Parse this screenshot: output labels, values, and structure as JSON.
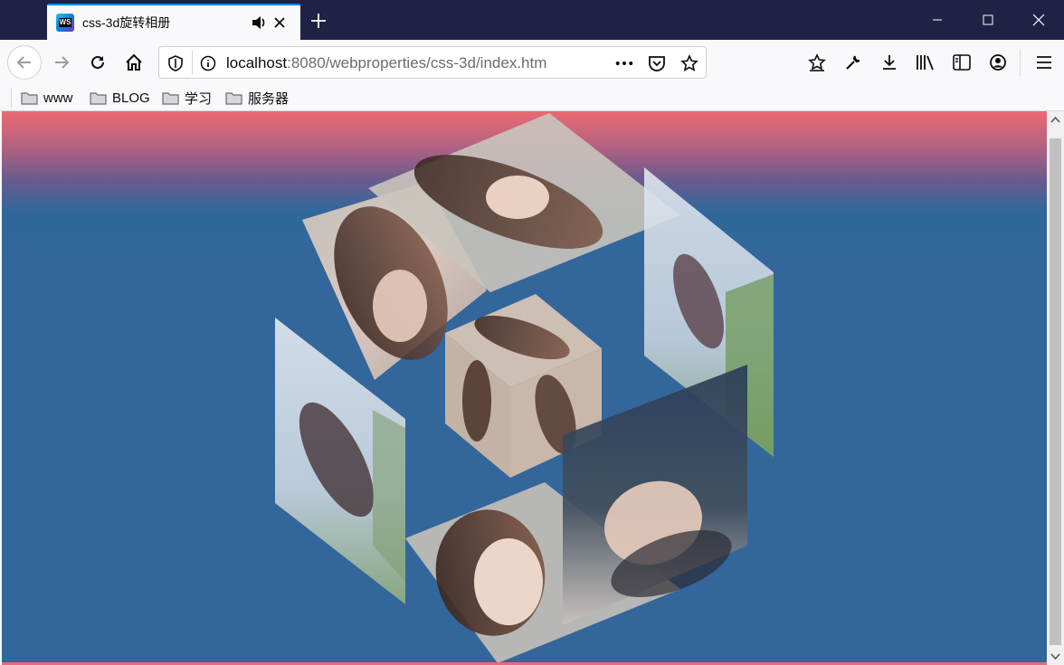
{
  "browser": {
    "tab": {
      "title": "css-3d旋转相册",
      "favicon_text": "WS"
    },
    "url": {
      "host": "localhost",
      "rest": ":8080/webproperties/css-3d/index.htm"
    },
    "bookmarks": [
      "www",
      "BLOG",
      "学习",
      "服务器"
    ]
  },
  "colors": {
    "tabstrip": "#1f2145",
    "accent": "#0a84ff",
    "page_top": "#ea6a72",
    "page_bg": "#33679b"
  },
  "icons": [
    "speaker-icon",
    "close-icon",
    "plus-icon",
    "minimize-icon",
    "maximize-icon",
    "back-icon",
    "forward-icon",
    "reload-icon",
    "home-icon",
    "shield-icon",
    "info-icon",
    "more-icon",
    "pocket-icon",
    "star-icon",
    "bookmark-star-icon",
    "wrench-icon",
    "download-icon",
    "library-icon",
    "sidebar-icon",
    "account-icon",
    "menu-icon",
    "folder-icon"
  ]
}
